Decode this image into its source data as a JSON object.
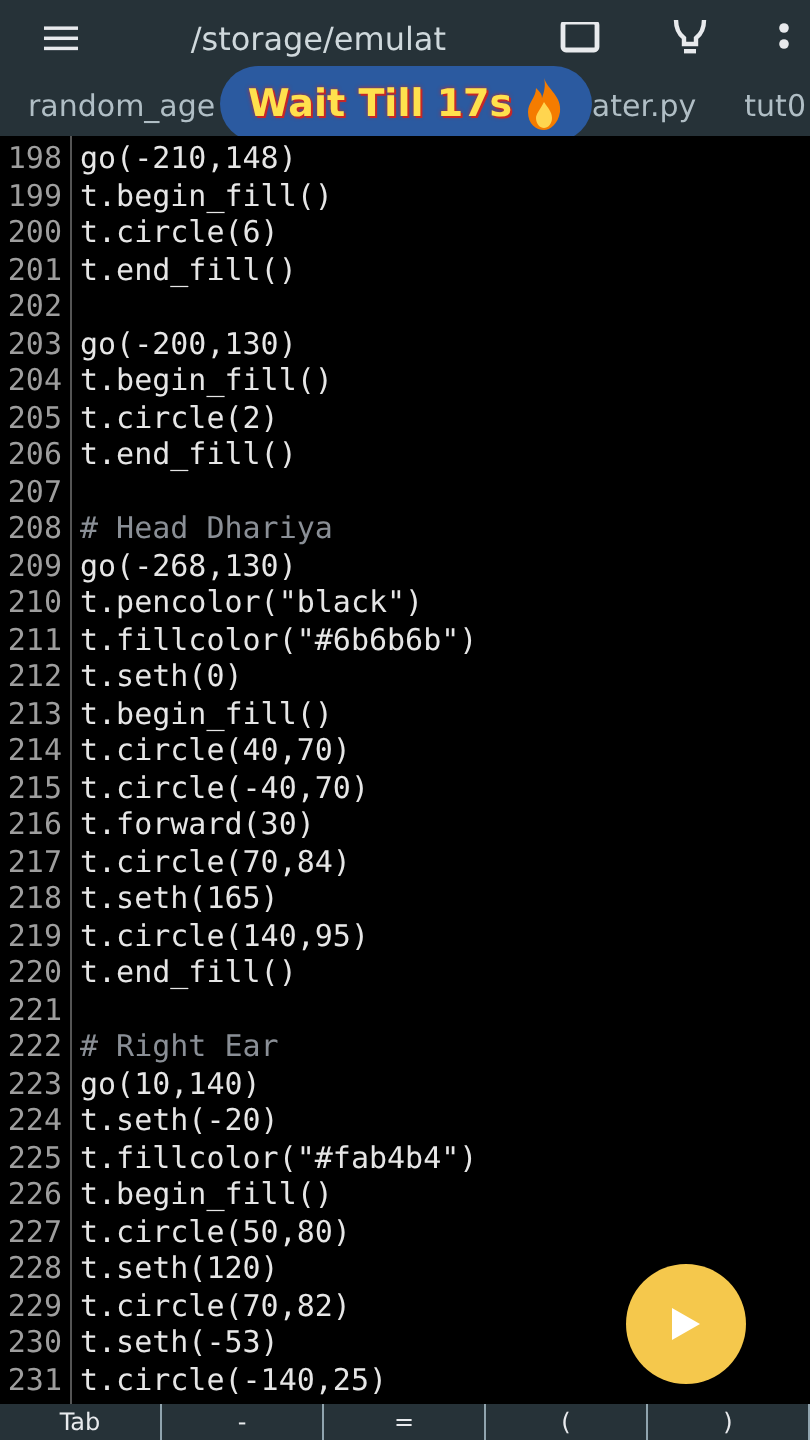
{
  "toolbar": {
    "subtitle": "/storage/emulat"
  },
  "tabs": [
    {
      "label": "random_age",
      "selected": false
    },
    {
      "label": "ater.py",
      "selected": false
    },
    {
      "label": "tut0",
      "selected": false
    }
  ],
  "overlay": {
    "text": "Wait Till 17s"
  },
  "lines": [
    {
      "number": "198",
      "kind": "code",
      "text": "go(-210,148)"
    },
    {
      "number": "199",
      "kind": "code",
      "text": "t.begin_fill()"
    },
    {
      "number": "200",
      "kind": "code",
      "text": "t.circle(6)"
    },
    {
      "number": "201",
      "kind": "code",
      "text": "t.end_fill()"
    },
    {
      "number": "202",
      "kind": "blank"
    },
    {
      "number": "203",
      "kind": "code",
      "text": "go(-200,130)"
    },
    {
      "number": "204",
      "kind": "code",
      "text": "t.begin_fill()"
    },
    {
      "number": "205",
      "kind": "code",
      "text": "t.circle(2)"
    },
    {
      "number": "206",
      "kind": "code",
      "text": "t.end_fill()"
    },
    {
      "number": "207",
      "kind": "blank"
    },
    {
      "number": "208",
      "kind": "comment",
      "text": "# Head Dhariya"
    },
    {
      "number": "209",
      "kind": "code",
      "text": "go(-268,130)"
    },
    {
      "number": "210",
      "kind": "code",
      "text": "t.pencolor(\"black\")"
    },
    {
      "number": "211",
      "kind": "code",
      "text": "t.fillcolor(\"#6b6b6b\")"
    },
    {
      "number": "212",
      "kind": "code",
      "text": "t.seth(0)"
    },
    {
      "number": "213",
      "kind": "code",
      "text": "t.begin_fill()"
    },
    {
      "number": "214",
      "kind": "code",
      "text": "t.circle(40,70)"
    },
    {
      "number": "215",
      "kind": "code",
      "text": "t.circle(-40,70)"
    },
    {
      "number": "216",
      "kind": "code",
      "text": "t.forward(30)"
    },
    {
      "number": "217",
      "kind": "code",
      "text": "t.circle(70,84)"
    },
    {
      "number": "218",
      "kind": "code",
      "text": "t.seth(165)"
    },
    {
      "number": "219",
      "kind": "code",
      "text": "t.circle(140,95)"
    },
    {
      "number": "220",
      "kind": "code",
      "text": "t.end_fill()"
    },
    {
      "number": "221",
      "kind": "blank"
    },
    {
      "number": "222",
      "kind": "comment",
      "text": "# Right Ear"
    },
    {
      "number": "223",
      "kind": "code",
      "text": "go(10,140)"
    },
    {
      "number": "224",
      "kind": "code",
      "text": "t.seth(-20)"
    },
    {
      "number": "225",
      "kind": "code",
      "text": "t.fillcolor(\"#fab4b4\")"
    },
    {
      "number": "226",
      "kind": "code",
      "text": "t.begin_fill()"
    },
    {
      "number": "227",
      "kind": "code",
      "text": "t.circle(50,80)"
    },
    {
      "number": "228",
      "kind": "code",
      "text": "t.seth(120)"
    },
    {
      "number": "229",
      "kind": "code",
      "text": "t.circle(70,82)"
    },
    {
      "number": "230",
      "kind": "code",
      "text": "t.seth(-53)"
    },
    {
      "number": "231",
      "kind": "code",
      "text": "t.circle(-140,25)"
    }
  ],
  "keys": [
    "Tab",
    "-",
    "=",
    "(",
    ")"
  ]
}
